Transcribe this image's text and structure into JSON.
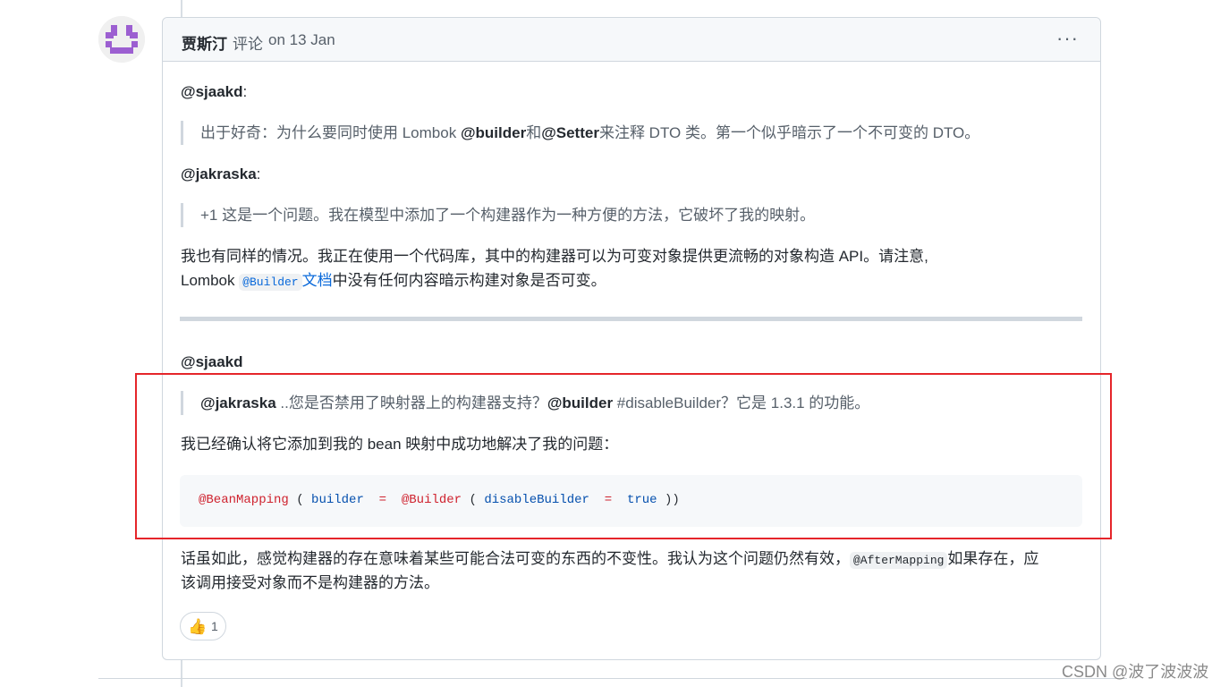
{
  "comment": {
    "author": "贾斯汀",
    "verb": "评论",
    "date": "on 13 Jan",
    "menu_label": "···"
  },
  "body": {
    "mention_1": "@sjaakd",
    "colon_1": ":",
    "quote_1": {
      "pre": "出于好奇：为什么要同时使用 Lombok ",
      "b1": "@builder",
      "mid": "和",
      "b2": "@Setter",
      "post": "来注释 DTO 类。第一个似乎暗示了一个不可变的 DTO。"
    },
    "mention_2": "@jakraska",
    "colon_2": ":",
    "quote_2": "+1 这是一个问题。我在模型中添加了一个构建器作为一种方便的方法，它破坏了我的映射。",
    "para_1_line_1": "我也有同样的情况。我正在使用一个代码库，其中的构建器可以为可变对象提供更流畅的对象构造 API。请注意,",
    "para_1_line_2_pre": "Lombok ",
    "para_1_code": "@Builder",
    "para_1_link": "文档",
    "para_1_line_2_post": "中没有任何内容暗示构建对象是否可变。",
    "mention_3": "@sjaakd",
    "quote_3": {
      "b1": "@jakraska",
      "mid": " ..您是否禁用了映射器上的构建器支持？",
      "b2": "@builder",
      "post": " #disableBuilder？它是 1.3.1 的功能。"
    },
    "para_2": "我已经确认将它添加到我的 bean 映射中成功地解决了我的问题：",
    "code": {
      "anno_1": "@BeanMapping",
      "p1": " ( ",
      "id_1": "builder",
      "eq_1": "  =  ",
      "anno_2": "@Builder",
      "p2": " ( ",
      "id_2": "disableBuilder",
      "eq_2": "  =  ",
      "kw": "true",
      "p3": " ))"
    },
    "para_3_line_1_pre": "话虽如此，感觉构建器的存在意味着某些可能合法可变的东西的不变性。我认为这个问题仍然有效，",
    "para_3_code": "@AfterMapping",
    "para_3_line_1_post": "如果存在，应",
    "para_3_line_2": "该调用接受对象而不是构建器的方法。"
  },
  "reaction": {
    "emoji": "👍",
    "count": "1"
  },
  "watermark": "CSDN @波了波波波",
  "colors": {
    "highlight_box": "#e5252a",
    "link": "#0969da",
    "annotation": "#cf222e",
    "identifier": "#0550ae"
  }
}
